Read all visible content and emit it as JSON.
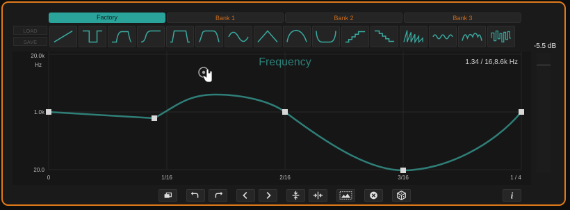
{
  "tabs": [
    {
      "label": "Factory",
      "active": true
    },
    {
      "label": "Bank 1",
      "active": false
    },
    {
      "label": "Bank 2",
      "active": false
    },
    {
      "label": "Bank 3",
      "active": false
    }
  ],
  "side_buttons": {
    "load": "LOAD",
    "save": "SAVE"
  },
  "shapes": [
    "ramp-up",
    "square-pulse",
    "rounded-pulse",
    "s-curve",
    "trapezoid",
    "rise-fall",
    "sine",
    "triangle",
    "arch",
    "bowl",
    "stairs-up",
    "stairs-down",
    "sawtooth",
    "wave",
    "peaks",
    "noise"
  ],
  "plot": {
    "title": "Frequency",
    "readout": "1.34 / 16,8.6k Hz",
    "y_labels": [
      "20.0k",
      "Hz",
      "1.0k",
      "20.0"
    ],
    "x_labels": [
      "0",
      "1/16",
      "2/16",
      "3/16",
      "1 / 4"
    ]
  },
  "meter": {
    "value": "-5.5 dB"
  },
  "toolbar": [
    "duplicate",
    "undo",
    "redo",
    "prev",
    "next",
    "flip-vertical",
    "flip-horizontal",
    "range",
    "clear",
    "randomize",
    "info"
  ],
  "colors": {
    "accent": "#2aa39a",
    "border": "#e07a1a",
    "bank_text": "#c86a1e",
    "curve": "#2f7f78"
  }
}
